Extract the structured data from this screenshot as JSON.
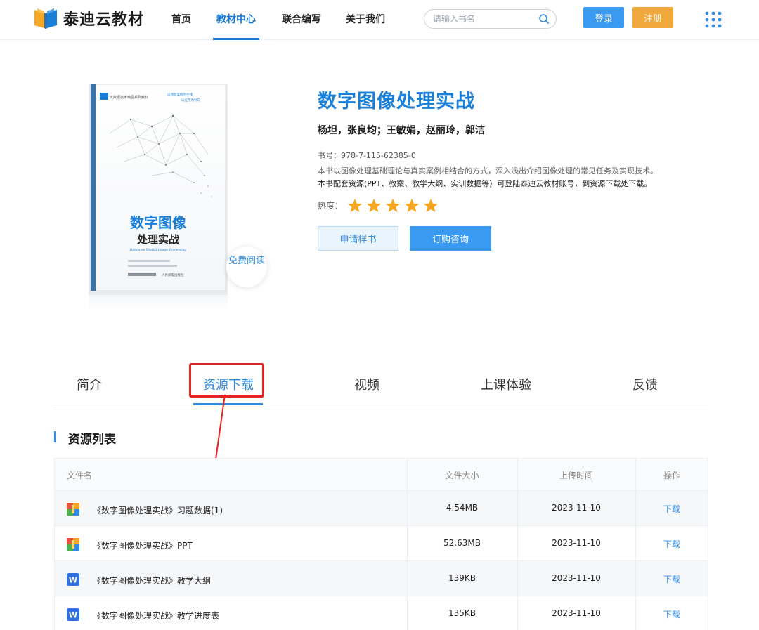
{
  "header": {
    "logo_text": "泰迪云教材",
    "nav": [
      {
        "label": "首页",
        "active": false
      },
      {
        "label": "教材中心",
        "active": true
      },
      {
        "label": "联合编写",
        "active": false
      },
      {
        "label": "关于我们",
        "active": false
      }
    ],
    "search_placeholder": "请输入书名",
    "login_label": "登录",
    "register_label": "注册"
  },
  "book": {
    "cover": {
      "series": "大数据技术精品系列教材",
      "tagline1": "以项目案例为主线",
      "tagline2": "以应用为导向",
      "title_line1": "数字图像",
      "title_line2": "处理实战",
      "title_en": "Hands-on Digital Image Processing",
      "publisher": "人民邮电出版社"
    },
    "free_read": "免费阅读",
    "title": "数字图像处理实战",
    "authors": "杨坦，张良均；王敏娟，赵丽玲，郭洁",
    "isbn": "书号：978-7-115-62385-0",
    "desc_line1": "本书以图像处理基础理论与真实案例相结合的方式，深入浅出介绍图像处理的常见任务及实现技术。",
    "desc_line2": "本书配套资源(PPT、教案、教学大纲、实训数据等）可登陆泰迪云教材账号，到资源下载处下载。",
    "heat_label": "热度：",
    "heat_stars": 5,
    "btn_sample": "申请样书",
    "btn_order": "订购咨询"
  },
  "tabs": [
    {
      "label": "简介",
      "active": false
    },
    {
      "label": "资源下载",
      "active": true
    },
    {
      "label": "视频",
      "active": false
    },
    {
      "label": "上课体验",
      "active": false
    },
    {
      "label": "反馈",
      "active": false
    }
  ],
  "resources": {
    "section_title": "资源列表",
    "columns": [
      "文件名",
      "文件大小",
      "上传时间",
      "操作"
    ],
    "rows": [
      {
        "icon": "archive-icon",
        "name": "《数字图像处理实战》习题数据(1)",
        "size": "4.54MB",
        "date": "2023-11-10",
        "action": "下载"
      },
      {
        "icon": "archive-icon",
        "name": "《数字图像处理实战》PPT",
        "size": "52.63MB",
        "date": "2023-11-10",
        "action": "下载"
      },
      {
        "icon": "word-doc-icon",
        "name": "《数字图像处理实战》教学大纲",
        "size": "139KB",
        "date": "2023-11-10",
        "action": "下载"
      },
      {
        "icon": "word-doc-icon",
        "name": "《数字图像处理实战》教学进度表",
        "size": "135KB",
        "date": "2023-11-10",
        "action": "下载"
      }
    ]
  },
  "colors": {
    "brand_blue": "#1a7fd9",
    "login_blue": "#3a9af2",
    "register_orange": "#f0a83c",
    "star_orange": "#f5a623",
    "annotation_red": "#e5231f"
  }
}
